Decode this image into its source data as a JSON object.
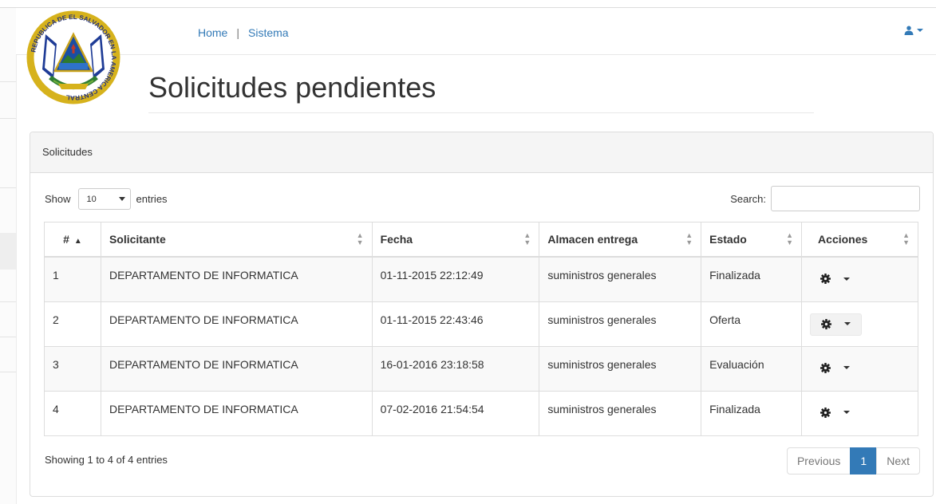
{
  "nav": {
    "home": "Home",
    "separator": "|",
    "sistema": "Sistema"
  },
  "user_menu": {
    "icon": "user-icon"
  },
  "page": {
    "title": "Solicitudes pendientes"
  },
  "panel": {
    "heading": "Solicitudes"
  },
  "table_controls": {
    "show_label": "Show",
    "entries_label": "entries",
    "page_length": "10",
    "search_label": "Search:",
    "search_value": ""
  },
  "table": {
    "columns": [
      "#",
      "Solicitante",
      "Fecha",
      "Almacen entrega",
      "Estado",
      "Acciones"
    ],
    "rows": [
      {
        "num": "1",
        "solicitante": "DEPARTAMENTO DE INFORMATICA",
        "fecha": "01-11-2015 22:12:49",
        "almacen": "suministros generales",
        "estado": "Finalizada"
      },
      {
        "num": "2",
        "solicitante": "DEPARTAMENTO DE INFORMATICA",
        "fecha": "01-11-2015 22:43:46",
        "almacen": "suministros generales",
        "estado": "Oferta"
      },
      {
        "num": "3",
        "solicitante": "DEPARTAMENTO DE INFORMATICA",
        "fecha": "16-01-2016 23:18:58",
        "almacen": "suministros generales",
        "estado": "Evaluación"
      },
      {
        "num": "4",
        "solicitante": "DEPARTAMENTO DE INFORMATICA",
        "fecha": "07-02-2016 21:54:54",
        "almacen": "suministros generales",
        "estado": "Finalizada"
      }
    ]
  },
  "footer": {
    "info": "Showing 1 to 4 of 4 entries",
    "previous": "Previous",
    "current_page": "1",
    "next": "Next"
  },
  "logo": {
    "ring_text": "REPUBLICA DE EL SALVADOR EN LA AMERICA CENTRAL",
    "icon": "coat-of-arms-icon"
  },
  "colors": {
    "link": "#337ab7",
    "active_page": "#337ab7",
    "panel_heading_bg": "#f5f5f5"
  }
}
